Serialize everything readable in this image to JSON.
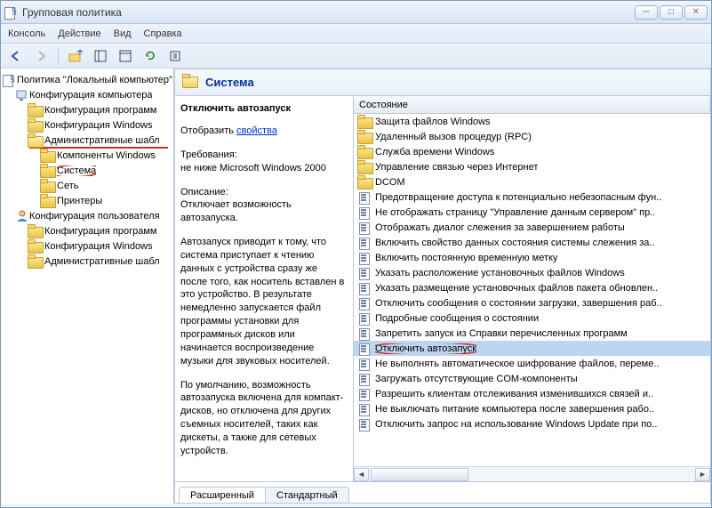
{
  "titlebar": {
    "title": "Групповая политика"
  },
  "menu": [
    "Консоль",
    "Действие",
    "Вид",
    "Справка"
  ],
  "tree": [
    {
      "d": 0,
      "icon": "gp",
      "label": "Политика \"Локальный компьютер\"",
      "open": true
    },
    {
      "d": 1,
      "icon": "cog",
      "label": "Конфигурация компьютера",
      "open": true
    },
    {
      "d": 2,
      "icon": "folder",
      "label": "Конфигурация программ"
    },
    {
      "d": 2,
      "icon": "folder",
      "label": "Конфигурация Windows"
    },
    {
      "d": 2,
      "icon": "folder-open",
      "label": "Административные шабл",
      "open": true,
      "underlined": true
    },
    {
      "d": 3,
      "icon": "folder",
      "label": "Компоненты Windows"
    },
    {
      "d": 3,
      "icon": "folder",
      "label": "Система",
      "ringed": true
    },
    {
      "d": 3,
      "icon": "folder",
      "label": "Сеть"
    },
    {
      "d": 3,
      "icon": "folder",
      "label": "Принтеры"
    },
    {
      "d": 1,
      "icon": "user",
      "label": "Конфигурация пользователя",
      "open": true
    },
    {
      "d": 2,
      "icon": "folder",
      "label": "Конфигурация программ"
    },
    {
      "d": 2,
      "icon": "folder",
      "label": "Конфигурация Windows"
    },
    {
      "d": 2,
      "icon": "folder",
      "label": "Административные шабл"
    }
  ],
  "header": {
    "title": "Система"
  },
  "desc": {
    "heading": "Отключить автозапуск",
    "show_label": "Отобразить ",
    "show_link": "свойства",
    "req_label": "Требования:",
    "req_text": "не ниже Microsoft Windows 2000",
    "sec_label": "Описание:",
    "p1": "Отключает возможность автозапуска.",
    "p2": "Автозапуск приводит к тому, что система приступает к чтению данных с устройства сразу же после того, как носитель вставлен в это устройство. В результате немедленно запускается файл программы установки для программных дисков или начинается воспроизведение музыки для звуковых носителей.",
    "p3": "По умолчанию, возможность автозапуска включена для компакт-дисков, но отключена для других съемных носителей, таких как дискеты, а также для сетевых устройств."
  },
  "list": {
    "col": "Состояние",
    "rows": [
      {
        "icon": "folder",
        "label": "Защита файлов Windows"
      },
      {
        "icon": "folder",
        "label": "Удаленный вызов процедур (RPC)"
      },
      {
        "icon": "folder",
        "label": "Служба времени Windows"
      },
      {
        "icon": "folder",
        "label": "Управление связью через Интернет"
      },
      {
        "icon": "folder",
        "label": "DCOM"
      },
      {
        "icon": "policy",
        "label": "Предотвращение доступа к потенциально небезопасным фун.."
      },
      {
        "icon": "policy",
        "label": "Не отображать страницу \"Управление данным сервером\" пр.."
      },
      {
        "icon": "policy",
        "label": "Отображать диалог слежения за завершением работы"
      },
      {
        "icon": "policy",
        "label": "Включить свойство данных состояния системы слежения за.."
      },
      {
        "icon": "policy",
        "label": "Включить постоянную временную метку"
      },
      {
        "icon": "policy",
        "label": "Указать расположение установочных файлов Windows"
      },
      {
        "icon": "policy",
        "label": "Указать размещение установочных файлов пакета обновлен.."
      },
      {
        "icon": "policy",
        "label": "Отключить сообщения о состоянии загрузки, завершения раб.."
      },
      {
        "icon": "policy",
        "label": "Подробные сообщения о состоянии"
      },
      {
        "icon": "policy",
        "label": "Запретить запуск из Справки перечисленных программ"
      },
      {
        "icon": "policy",
        "label": "Отключить автозапуск",
        "ringed": true,
        "selected": true
      },
      {
        "icon": "policy",
        "label": "Не выполнять автоматическое шифрование файлов, переме.."
      },
      {
        "icon": "policy",
        "label": "Загружать отсутствующие COM-компоненты"
      },
      {
        "icon": "policy",
        "label": "Разрешить клиентам отслеживания изменившихся связей и.."
      },
      {
        "icon": "policy",
        "label": "Не выключать питание компьютера после завершения рабо.."
      },
      {
        "icon": "policy",
        "label": "Отключить запрос на использование Windows Update при по.."
      }
    ]
  },
  "tabs": {
    "extended": "Расширенный",
    "standard": "Стандартный"
  }
}
